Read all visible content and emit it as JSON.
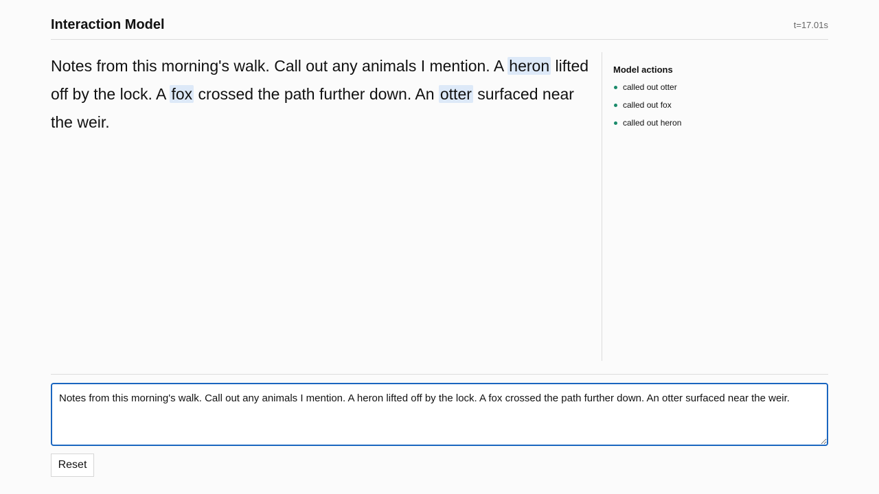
{
  "header": {
    "title": "Interaction Model",
    "timer": "t=17.01s"
  },
  "transcript": {
    "segments": [
      {
        "text": "Notes from this morning's walk. Call out any animals I mention. A ",
        "highlight": false
      },
      {
        "text": "heron",
        "highlight": true
      },
      {
        "text": " lifted off by the lock. A ",
        "highlight": false
      },
      {
        "text": "fox",
        "highlight": true
      },
      {
        "text": " crossed the path further down. An ",
        "highlight": false
      },
      {
        "text": "otter",
        "highlight": true
      },
      {
        "text": " surfaced near the weir.",
        "highlight": false
      }
    ]
  },
  "actions": {
    "heading": "Model actions",
    "items": [
      {
        "label": "called out otter"
      },
      {
        "label": "called out fox"
      },
      {
        "label": "called out heron"
      }
    ],
    "bullet_color": "#1a8a6a"
  },
  "input": {
    "value": "Notes from this morning's walk. Call out any animals I mention. A heron lifted off by the lock. A fox crossed the path further down. An otter surfaced near the weir."
  },
  "controls": {
    "reset_label": "Reset"
  },
  "colors": {
    "accent": "#1a66c0",
    "highlight": "#dde9f8"
  }
}
